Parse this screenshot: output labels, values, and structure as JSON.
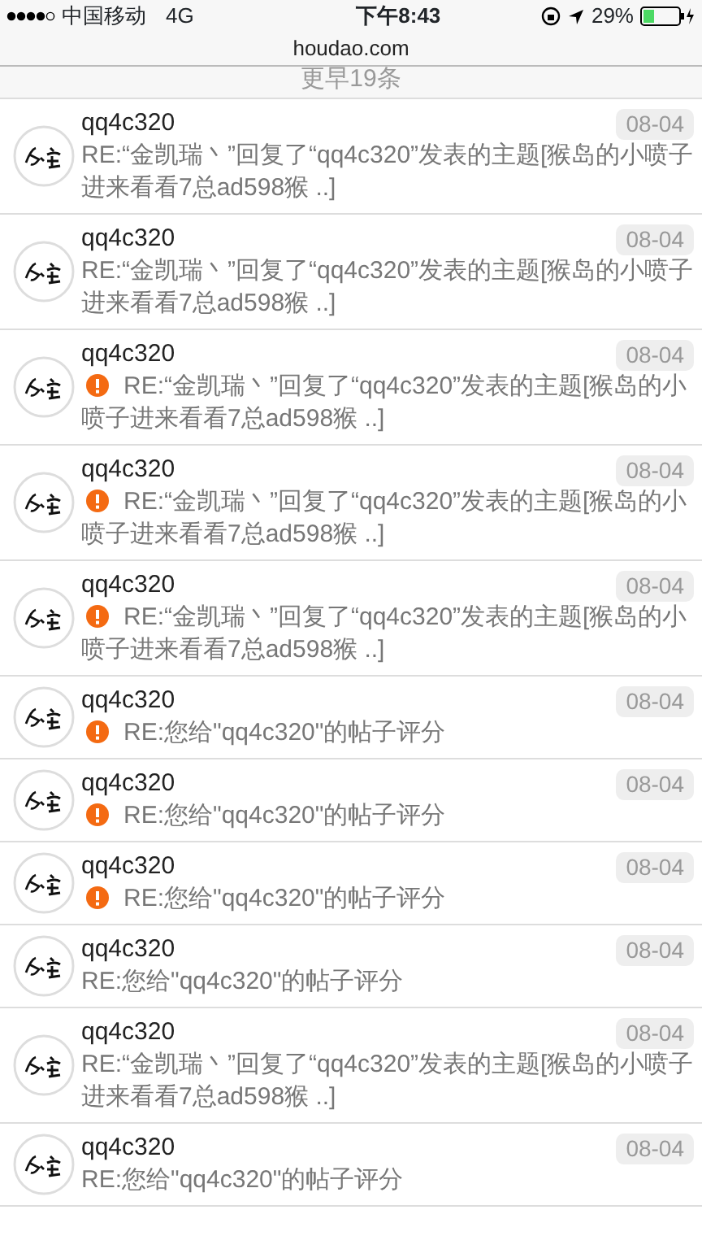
{
  "status_bar": {
    "carrier": "中国移动",
    "network": "4G",
    "time": "下午8:43",
    "battery": "29%"
  },
  "address_bar": {
    "url": "houdao.com"
  },
  "earlier": "更早19条",
  "messages": [
    {
      "user": "qq4c320",
      "date": "08-04",
      "alert": false,
      "text": "RE:“金凯瑞丶”回复了“qq4c320”发表的主题[猴岛的小喷子进来看看7总ad598猴 ..]"
    },
    {
      "user": "qq4c320",
      "date": "08-04",
      "alert": false,
      "text": "RE:“金凯瑞丶”回复了“qq4c320”发表的主题[猴岛的小喷子进来看看7总ad598猴 ..]"
    },
    {
      "user": "qq4c320",
      "date": "08-04",
      "alert": true,
      "text": "RE:“金凯瑞丶”回复了“qq4c320”发表的主题[猴岛的小喷子进来看看7总ad598猴 ..]"
    },
    {
      "user": "qq4c320",
      "date": "08-04",
      "alert": true,
      "text": "RE:“金凯瑞丶”回复了“qq4c320”发表的主题[猴岛的小喷子进来看看7总ad598猴 ..]"
    },
    {
      "user": "qq4c320",
      "date": "08-04",
      "alert": true,
      "text": "RE:“金凯瑞丶”回复了“qq4c320”发表的主题[猴岛的小喷子进来看看7总ad598猴 ..]"
    },
    {
      "user": "qq4c320",
      "date": "08-04",
      "alert": true,
      "text": "RE:您给\"qq4c320\"的帖子评分"
    },
    {
      "user": "qq4c320",
      "date": "08-04",
      "alert": true,
      "text": "RE:您给\"qq4c320\"的帖子评分"
    },
    {
      "user": "qq4c320",
      "date": "08-04",
      "alert": true,
      "text": "RE:您给\"qq4c320\"的帖子评分"
    },
    {
      "user": "qq4c320",
      "date": "08-04",
      "alert": false,
      "text": "RE:您给\"qq4c320\"的帖子评分"
    },
    {
      "user": "qq4c320",
      "date": "08-04",
      "alert": false,
      "text": "RE:“金凯瑞丶”回复了“qq4c320”发表的主题[猴岛的小喷子进来看看7总ad598猴 ..]"
    },
    {
      "user": "qq4c320",
      "date": "08-04",
      "alert": false,
      "text": "RE:您给\"qq4c320\"的帖子评分"
    }
  ]
}
